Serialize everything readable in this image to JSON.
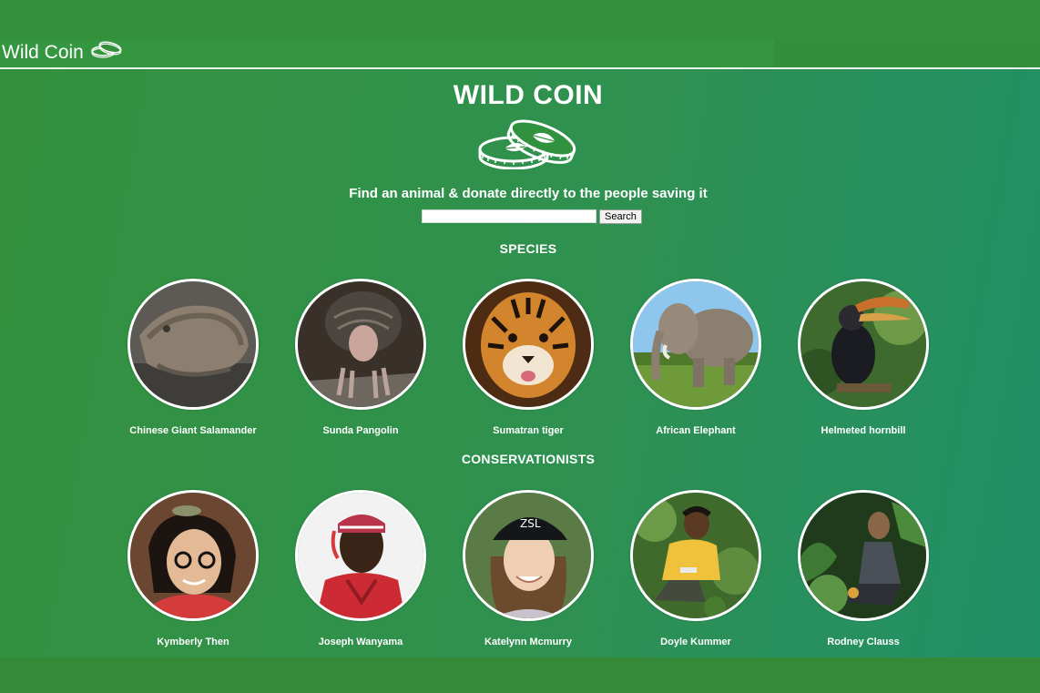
{
  "nav": {
    "brand": "Wild Coin",
    "logo_icon": "coins-icon"
  },
  "hero": {
    "title": "WILD COIN",
    "logo_icon": "coins-leaf-icon",
    "tagline": "Find an animal & donate directly to the people saving it"
  },
  "search": {
    "placeholder": "",
    "value": "",
    "button_label": "Search"
  },
  "species": {
    "heading": "SPECIES",
    "items": [
      {
        "label": "Chinese Giant Salamander",
        "image": "salamander-photo"
      },
      {
        "label": "Sunda Pangolin",
        "image": "pangolin-photo"
      },
      {
        "label": "Sumatran tiger",
        "image": "tiger-photo"
      },
      {
        "label": "African Elephant",
        "image": "elephant-photo"
      },
      {
        "label": "Helmeted hornbill",
        "image": "hornbill-photo"
      }
    ]
  },
  "conservationists": {
    "heading": "CONSERVATIONISTS",
    "items": [
      {
        "label": "Kymberly Then",
        "image": "portrait-photo"
      },
      {
        "label": "Joseph Wanyama",
        "image": "portrait-photo"
      },
      {
        "label": "Katelynn Mcmurry",
        "image": "portrait-photo"
      },
      {
        "label": "Doyle Kummer",
        "image": "portrait-photo"
      },
      {
        "label": "Rodney Clauss",
        "image": "portrait-photo"
      }
    ]
  },
  "colors": {
    "brand_green": "#348f3c",
    "accent_white": "#ffffff"
  }
}
